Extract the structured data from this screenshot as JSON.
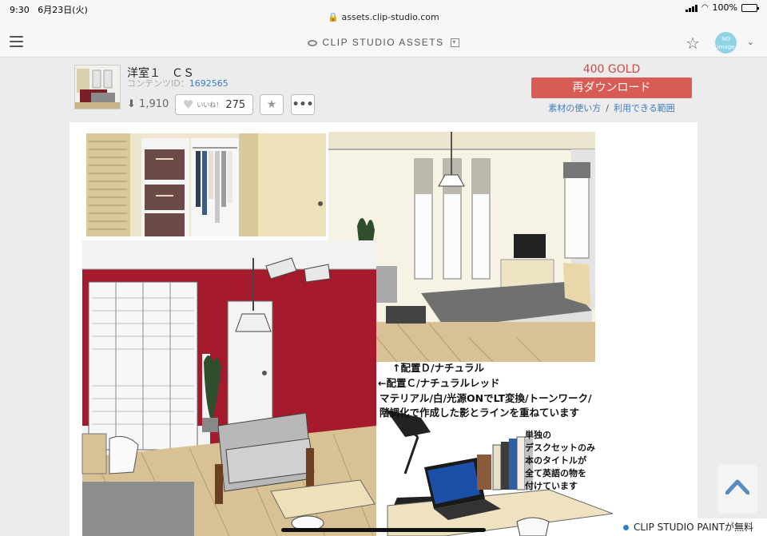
{
  "status_bar": {
    "time": "9:30",
    "date": "6月23日(火)",
    "url": "assets.clip-studio.com",
    "battery": "100%",
    "battery_level": 1.0
  },
  "header": {
    "brand": "CLIP STUDIO ASSETS",
    "avatar_text": "NO image"
  },
  "content": {
    "title": "洋室１　ＣＳ",
    "content_id_label": "コンテンツID：",
    "content_id": "1692565",
    "downloads": "1,910",
    "like_label": "いいね！",
    "like_count": "275",
    "price": "400 GOLD",
    "download_button": "再ダウンロード",
    "link_usage": "素材の使い方",
    "link_scope": "利用できる範囲"
  },
  "preview": {
    "annotations": [
      "↑配置Ｄ/ナチュラル",
      "←配置Ｃ/ナチュラルレッド",
      "マテリアル/白/光源ONでLT変換/トーンワーク/",
      "階調化で作成した影とラインを重ねています"
    ],
    "desk_note": [
      "単独の",
      "デスクセットのみ",
      "本のタイトルが",
      "全て英語の物を",
      "付けています"
    ]
  },
  "promo": "CLIP STUDIO PAINTが無料"
}
